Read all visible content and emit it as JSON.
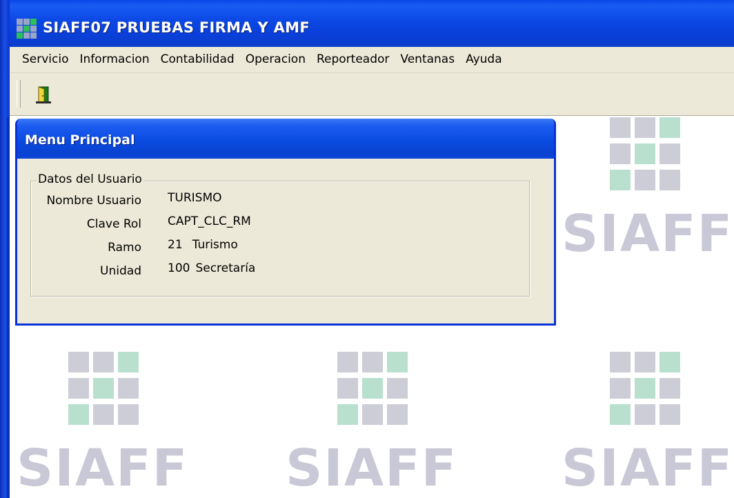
{
  "window": {
    "title": "SIAFF07 PRUEBAS FIRMA Y AMF"
  },
  "menu": {
    "items": [
      "Servicio",
      "Informacion",
      "Contabilidad",
      "Operacion",
      "Reporteador",
      "Ventanas",
      "Ayuda"
    ]
  },
  "toolbar": {
    "exit_icon": "exit-door-icon"
  },
  "child_window": {
    "title": "Menu Principal",
    "group": {
      "legend": "Datos del Usuario",
      "fields": [
        {
          "label": "Nombre Usuario",
          "value": "TURISMO"
        },
        {
          "label": "Clave Rol",
          "value": "CAPT_CLC_RM"
        },
        {
          "label": "Ramo",
          "code": "21",
          "value": "Turismo"
        },
        {
          "label": "Unidad",
          "code": "100",
          "value": "Secretaría"
        }
      ]
    }
  },
  "watermark": {
    "text": "SIAFF",
    "text_color": "#c9c8d6",
    "square_color": "#cdcdd8",
    "accent_color": "#b9e0cf"
  },
  "colors": {
    "titlebar": "#0a46e8",
    "chrome": "#ece9d8"
  }
}
